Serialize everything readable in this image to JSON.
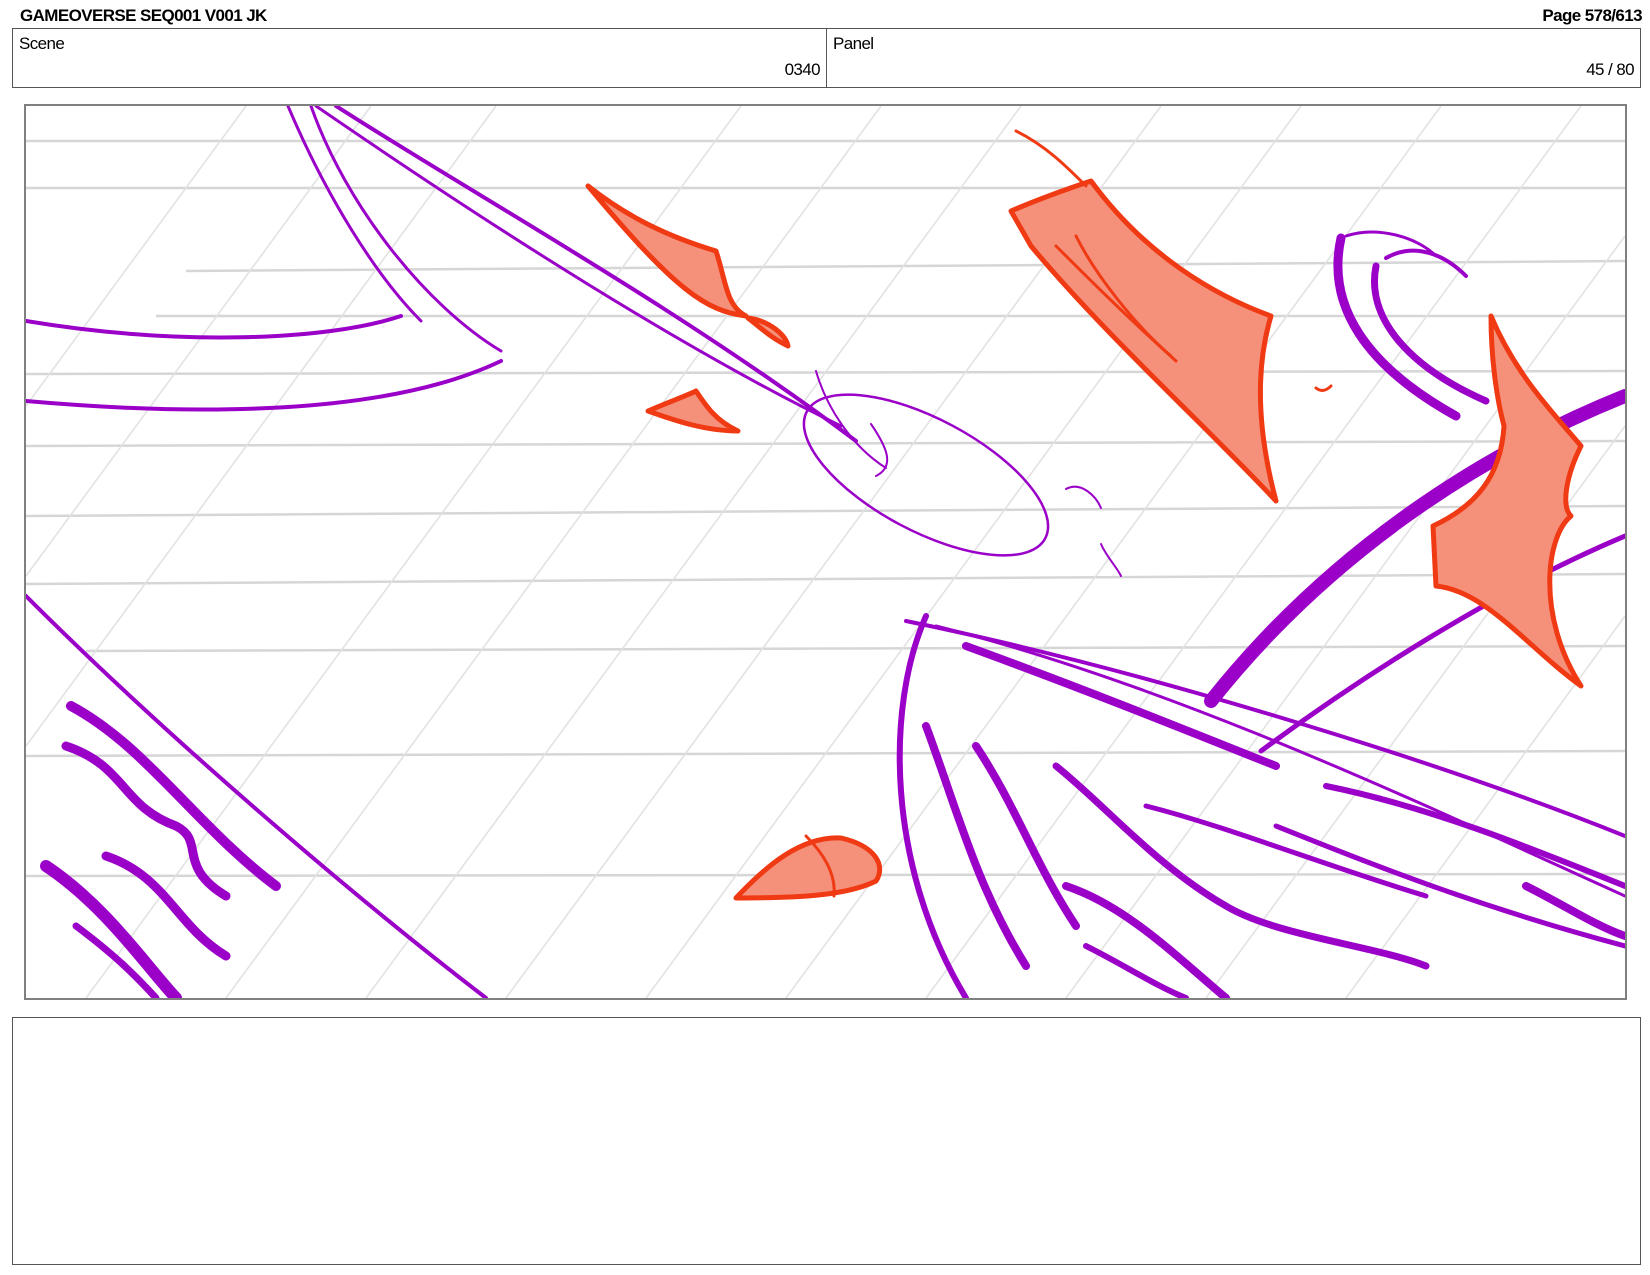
{
  "header": {
    "title": "GAMEOVERSE SEQ001 V001 JK",
    "page": "Page 578/613"
  },
  "scene": {
    "label": "Scene",
    "value": "0340"
  },
  "panel": {
    "label": "Panel",
    "value": "45 / 80"
  },
  "artwork": {
    "description_icon": "storyboard-sketch",
    "colors": {
      "stroke_primary": "#9a00c8",
      "fill_accent": "#f5907a",
      "stroke_accent": "#f03a14",
      "guide_lines": "#d6d6d6"
    }
  },
  "notes": {
    "text": ""
  }
}
